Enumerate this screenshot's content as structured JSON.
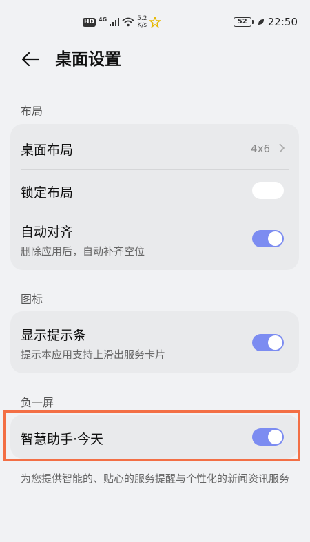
{
  "status_bar": {
    "hd": "HD",
    "network": "4G",
    "speed_value": "5.2",
    "speed_unit": "K/s",
    "battery": "52",
    "time": "22:50"
  },
  "header": {
    "title": "桌面设置"
  },
  "sections": {
    "layout": {
      "title": "布局",
      "desktop_layout": {
        "label": "桌面布局",
        "value": "4x6"
      },
      "lock_layout": {
        "label": "锁定布局",
        "enabled": false
      },
      "auto_align": {
        "label": "自动对齐",
        "desc": "删除应用后，自动补齐空位",
        "enabled": true
      }
    },
    "icons": {
      "title": "图标",
      "show_hint_bar": {
        "label": "显示提示条",
        "desc": "提示本应用支持上滑出服务卡片",
        "enabled": true
      }
    },
    "minus_one": {
      "title": "负一屏",
      "smart_assistant": {
        "label": "智慧助手·今天",
        "enabled": true
      },
      "desc": "为您提供智能的、贴心的服务提醒与个性化的新闻资讯服务"
    }
  },
  "colors": {
    "accent": "#7c8cf1",
    "highlight": "#f36f45",
    "background": "#f1f2f4",
    "card": "#e9eaec"
  }
}
